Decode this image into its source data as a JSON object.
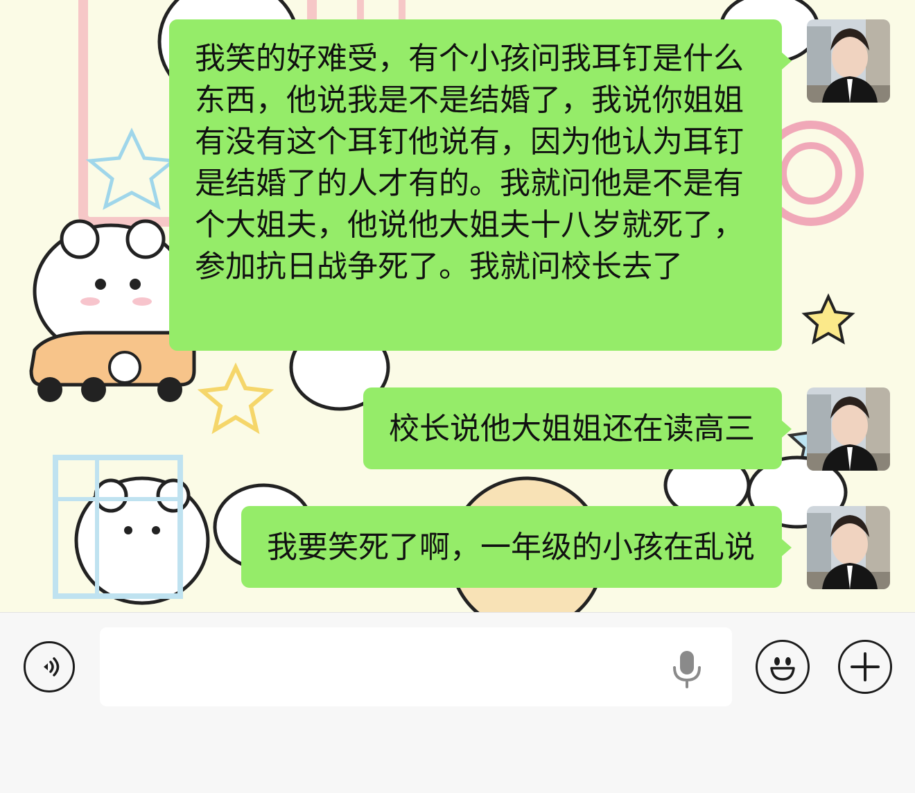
{
  "messages": [
    {
      "sender": "self",
      "text": "我笑的好难受，有个小孩问我耳钉是什么东西，他说我是不是结婚了，我说你姐姐有没有这个耳钉他说有，因为他认为耳钉是结婚了的人才有的。我就问他是不是有个大姐夫，他说他大姐夫十八岁就死了，参加抗日战争死了。我就问校长去了"
    },
    {
      "sender": "self",
      "text": "校长说他大姐姐还在读高三"
    },
    {
      "sender": "self",
      "text": "我要笑死了啊，一年级的小孩在乱说"
    }
  ],
  "composer": {
    "value": "",
    "voice_icon": "voice-toggle-icon",
    "mic_icon": "microphone-icon",
    "emoji_icon": "emoji-face-icon",
    "more_icon": "plus-icon"
  },
  "colors": {
    "bubble": "#95ec69",
    "wallpaper": "#fbfbe6",
    "input_bar": "#f7f7f7"
  }
}
